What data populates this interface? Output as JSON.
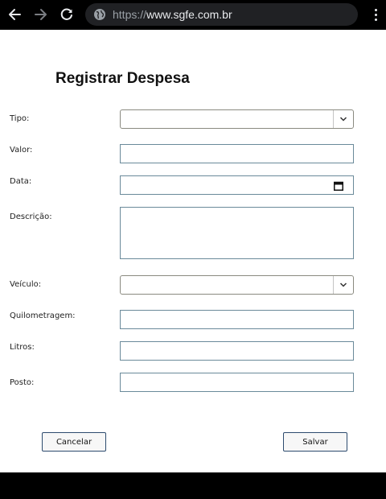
{
  "browser": {
    "url_scheme": "https://",
    "url_host": "www.sgfe.com.br"
  },
  "form": {
    "title": "Registrar Despesa",
    "fields": {
      "tipo": {
        "label": "Tipo:",
        "value": ""
      },
      "valor": {
        "label": "Valor:",
        "value": ""
      },
      "data": {
        "label": "Data:",
        "value": ""
      },
      "descricao": {
        "label": "Descrição:",
        "value": ""
      },
      "veiculo": {
        "label": "Veículo:",
        "value": ""
      },
      "quilometragem": {
        "label": "Quilometragem:",
        "value": ""
      },
      "litros": {
        "label": "Litros:",
        "value": ""
      },
      "posto": {
        "label": "Posto:",
        "value": ""
      }
    },
    "buttons": {
      "cancel": "Cancelar",
      "save": "Salvar"
    }
  },
  "icons": {
    "back": "arrow-left-icon",
    "forward": "arrow-right-icon",
    "reload": "reload-icon",
    "site_info": "globe-icon",
    "menu": "kebab-menu-icon",
    "dropdown": "chevron-down-icon",
    "calendar": "calendar-icon"
  }
}
